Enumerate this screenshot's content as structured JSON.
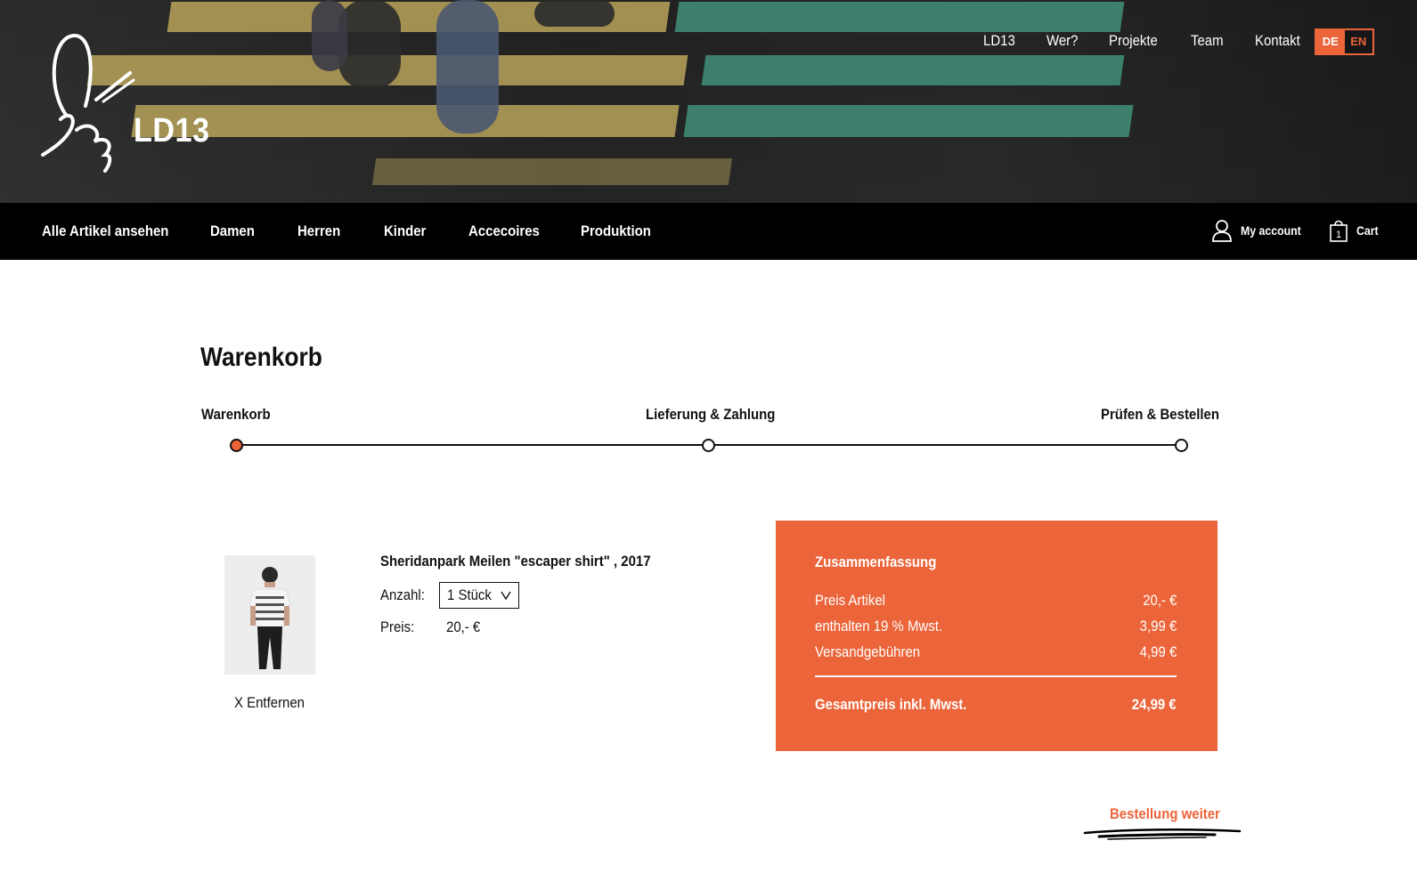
{
  "brand": {
    "name": "LD13"
  },
  "top_nav": [
    "LD13",
    "Wer?",
    "Projekte",
    "Team",
    "Kontakt"
  ],
  "language": {
    "active": "DE",
    "inactive": "EN"
  },
  "main_nav": [
    "Alle Artikel ansehen",
    "Damen",
    "Herren",
    "Kinder",
    "Accecoires",
    "Produktion"
  ],
  "account": {
    "label": "My account"
  },
  "cart": {
    "label": "Cart",
    "count": "1"
  },
  "page": {
    "title": "Warenkorb"
  },
  "steps": [
    {
      "label": "Warenkorb",
      "active": true
    },
    {
      "label": "Lieferung & Zahlung",
      "active": false
    },
    {
      "label": "Prüfen & Bestellen",
      "active": false
    }
  ],
  "item": {
    "name": "Sheridanpark Meilen \"escaper shirt\" , 2017",
    "quantity_label": "Anzahl:",
    "quantity_value": "1 Stück",
    "price_label": "Preis:",
    "price_value": "20,- €",
    "remove_label": "X Entfernen"
  },
  "summary": {
    "title": "Zusammenfassung",
    "rows": [
      {
        "label": "Preis Artikel",
        "value": "20,- €"
      },
      {
        "label": "enthalten 19 % Mwst.",
        "value": "3,99 €"
      },
      {
        "label": "Versandgebühren",
        "value": "4,99 €"
      }
    ],
    "total_label": "Gesamtpreis inkl. Mwst.",
    "total_value": "24,99 €"
  },
  "checkout": {
    "label": "Bestellung weiter"
  },
  "colors": {
    "accent": "#ec6439",
    "nav_bg": "#000000"
  }
}
